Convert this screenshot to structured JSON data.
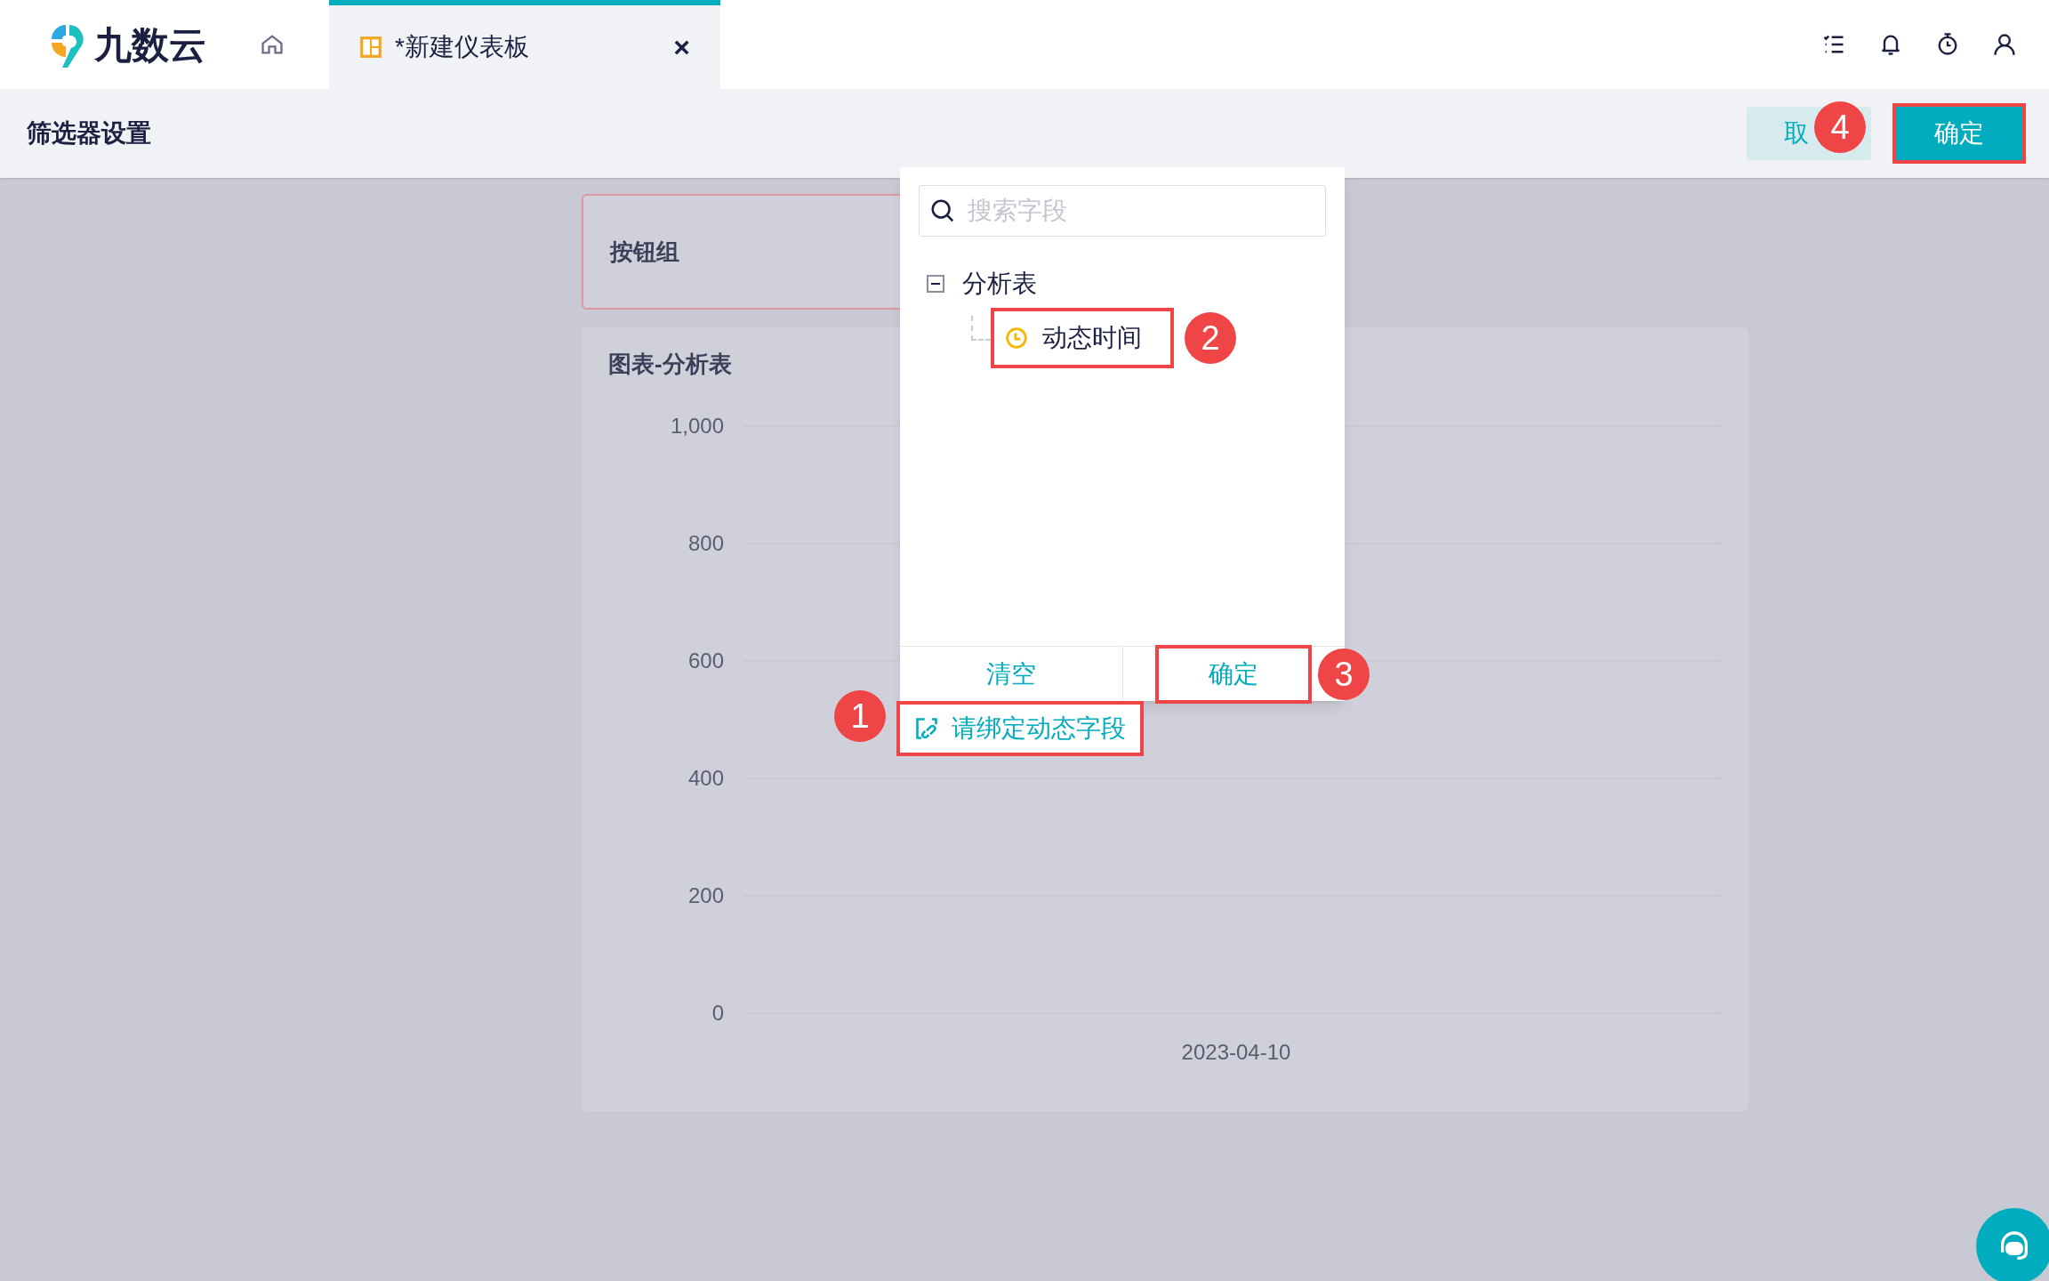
{
  "app": {
    "logo_text": "九数云"
  },
  "tabs": [
    {
      "label": "*新建仪表板",
      "selected": true,
      "close": "×"
    }
  ],
  "header": {
    "title": "筛选器设置",
    "buttons": [
      {
        "label": "取",
        "kind": "secondary",
        "highlighted": false,
        "badge": "4"
      },
      {
        "label": "确定",
        "kind": "primary",
        "highlighted": true
      }
    ]
  },
  "filter_card": {
    "title": "按钮组"
  },
  "chart_card": {
    "title": "图表-分析表",
    "y_labels": [
      "1,000",
      "800",
      "600",
      "400",
      "200",
      "0"
    ],
    "x_label": "2023-04-10"
  },
  "popup": {
    "search": {
      "placeholder": "搜索字段"
    },
    "tree": [
      {
        "label": "分析表",
        "expanded": true,
        "children": [
          {
            "label": "动态时间",
            "kind": "time",
            "highlighted": true,
            "badge": "2"
          }
        ]
      }
    ],
    "footer": [
      {
        "label": "清空",
        "highlighted": false
      },
      {
        "label": "确定",
        "highlighted": true,
        "badge": "3"
      }
    ]
  },
  "bind_link": {
    "label": "请绑定动态字段",
    "highlighted": true,
    "badge": "1"
  }
}
